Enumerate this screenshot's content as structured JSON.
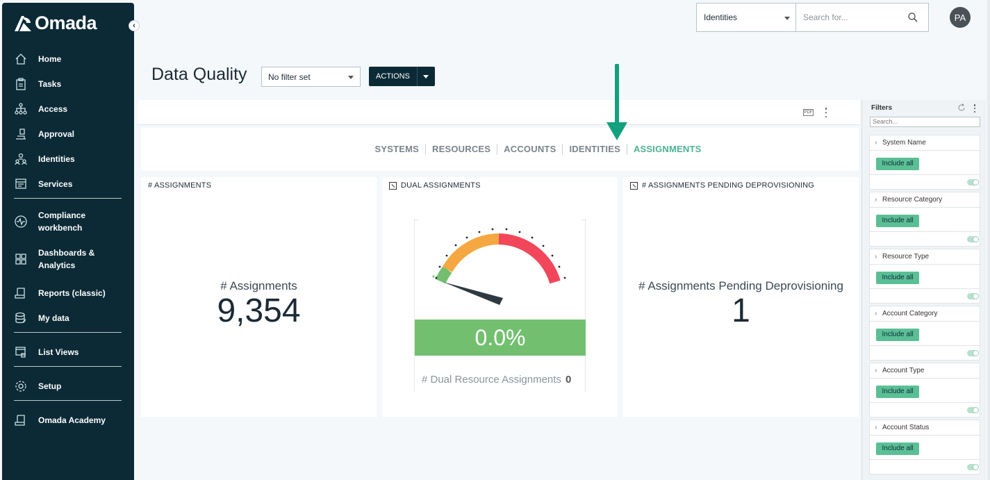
{
  "app": {
    "logo_text": "Omada"
  },
  "sidebar": {
    "collapse_icon": "chevron-left-icon",
    "items": [
      {
        "label": "Home",
        "icon": "home-icon"
      },
      {
        "label": "Tasks",
        "icon": "clipboard-icon"
      },
      {
        "label": "Access",
        "icon": "hierarchy-icon"
      },
      {
        "label": "Approval",
        "icon": "approval-icon"
      },
      {
        "label": "Identities",
        "icon": "people-icon"
      },
      {
        "label": "Services",
        "icon": "services-icon"
      },
      {
        "label": "Compliance workbench",
        "icon": "pulse-icon"
      },
      {
        "label": "Dashboards & Analytics",
        "icon": "grid-icon"
      },
      {
        "label": "Reports (classic)",
        "icon": "report-icon"
      },
      {
        "label": "My data",
        "icon": "database-icon"
      },
      {
        "label": "List Views",
        "icon": "list-view-icon"
      },
      {
        "label": "Setup",
        "icon": "gear-icon"
      },
      {
        "label": "Omada Academy",
        "icon": "academy-icon"
      }
    ]
  },
  "topbar": {
    "search_scope": "Identities",
    "search_placeholder": "Search for...",
    "avatar_initials": "PA"
  },
  "page": {
    "title": "Data Quality",
    "filter_select": "No filter set",
    "actions_label": "ACTIONS"
  },
  "toolbar": {
    "pdf_label": "PDF"
  },
  "tabs": [
    {
      "label": "SYSTEMS",
      "active": false
    },
    {
      "label": "RESOURCES",
      "active": false
    },
    {
      "label": "ACCOUNTS",
      "active": false
    },
    {
      "label": "IDENTITIES",
      "active": false
    },
    {
      "label": "ASSIGNMENTS",
      "active": true
    }
  ],
  "cards": {
    "assignments": {
      "title": "# ASSIGNMENTS",
      "label": "# Assignments",
      "value": "9,354"
    },
    "dual": {
      "title": "DUAL ASSIGNMENTS",
      "gauge_value": "0.0%",
      "gauge_fraction": 0.0,
      "footer_label": "# Dual Resource Assignments",
      "footer_value": "0"
    },
    "pending": {
      "title": "# ASSIGNMENTS PENDING DEPROVISIONING",
      "label": "# Assignments Pending Deprovisioning",
      "value": "1"
    }
  },
  "filters": {
    "title": "Filters",
    "search_placeholder": "Search...",
    "include_label": "Include all",
    "groups": [
      "System Name",
      "Resource Category",
      "Resource Type",
      "Account Category",
      "Account Type",
      "Account Status"
    ]
  },
  "colors": {
    "sidebar_bg": "#0b2a36",
    "accent_green": "#4db38f",
    "gauge_green": "#72c06f",
    "gauge_orange": "#f5a742",
    "gauge_red": "#f2475a"
  }
}
